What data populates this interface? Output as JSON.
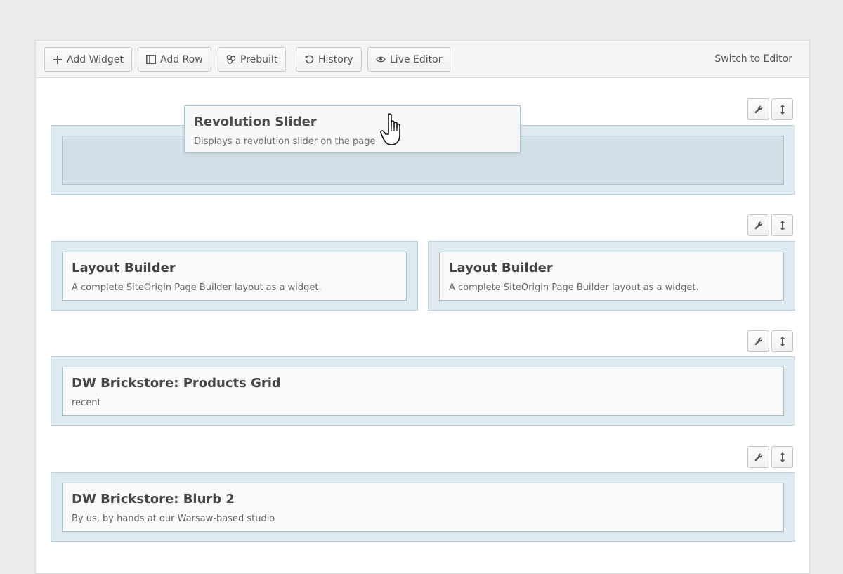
{
  "toolbar": {
    "add_widget": "Add Widget",
    "add_row": "Add Row",
    "prebuilt": "Prebuilt",
    "history": "History",
    "live_editor": "Live Editor",
    "switch_to_editor": "Switch to Editor"
  },
  "dragging_widget": {
    "title": "Revolution Slider",
    "description": "Displays a revolution slider on the page"
  },
  "rows": [
    {
      "cells": [
        {
          "placeholder": true
        }
      ]
    },
    {
      "cells": [
        {
          "title": "Layout Builder",
          "description": "A complete SiteOrigin Page Builder layout as a widget."
        },
        {
          "title": "Layout Builder",
          "description": "A complete SiteOrigin Page Builder layout as a widget."
        }
      ]
    },
    {
      "cells": [
        {
          "title": "DW Brickstore: Products Grid",
          "description": "recent"
        }
      ]
    },
    {
      "cells": [
        {
          "title": "DW Brickstore: Blurb 2",
          "description": "By us, by hands at our Warsaw-based studio"
        }
      ]
    }
  ],
  "icons": {
    "row_edit": "wrench-icon",
    "row_move": "vertical-move-icon"
  },
  "colors": {
    "cell_bg": "#dfeaf0",
    "cell_border": "#bcd2de",
    "widget_bg": "#f9f9fa",
    "placeholder_bg": "#d2e1e8"
  }
}
